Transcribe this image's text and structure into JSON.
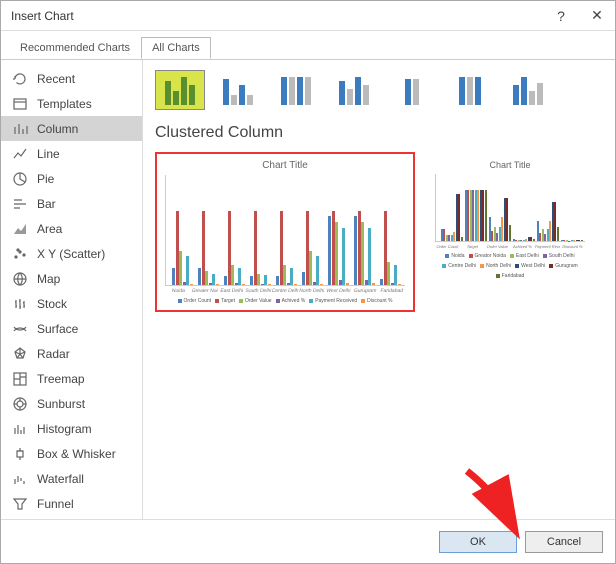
{
  "window": {
    "title": "Insert Chart",
    "help": "?",
    "close": "✕"
  },
  "tabs": {
    "recommended": "Recommended Charts",
    "all": "All Charts"
  },
  "sidebar": {
    "items": [
      {
        "label": "Recent",
        "icon": "recent"
      },
      {
        "label": "Templates",
        "icon": "templates"
      },
      {
        "label": "Column",
        "icon": "column"
      },
      {
        "label": "Line",
        "icon": "line"
      },
      {
        "label": "Pie",
        "icon": "pie"
      },
      {
        "label": "Bar",
        "icon": "bar"
      },
      {
        "label": "Area",
        "icon": "area"
      },
      {
        "label": "X Y (Scatter)",
        "icon": "scatter"
      },
      {
        "label": "Map",
        "icon": "map"
      },
      {
        "label": "Stock",
        "icon": "stock"
      },
      {
        "label": "Surface",
        "icon": "surface"
      },
      {
        "label": "Radar",
        "icon": "radar"
      },
      {
        "label": "Treemap",
        "icon": "treemap"
      },
      {
        "label": "Sunburst",
        "icon": "sunburst"
      },
      {
        "label": "Histogram",
        "icon": "histogram"
      },
      {
        "label": "Box & Whisker",
        "icon": "box"
      },
      {
        "label": "Waterfall",
        "icon": "waterfall"
      },
      {
        "label": "Funnel",
        "icon": "funnel"
      },
      {
        "label": "Combo",
        "icon": "combo"
      }
    ],
    "active": 2
  },
  "main": {
    "headline": "Clustered Column"
  },
  "preview1": {
    "title": "Chart Title",
    "type": "clustered-column-by-row",
    "categories": [
      "Noida",
      "Greater Noida",
      "East Delhi",
      "South Delhi",
      "Centre Delhi",
      "North Delhi",
      "West Delhi",
      "Gurugram",
      "Faridabad"
    ],
    "series": [
      {
        "name": "Order Count",
        "color": "#4f81bd"
      },
      {
        "name": "Target",
        "color": "#c0504d"
      },
      {
        "name": "Order Value",
        "color": "#9bbb59"
      },
      {
        "name": "Achived %",
        "color": "#8064a2"
      },
      {
        "name": "Payment Received",
        "color": "#4bacc6"
      },
      {
        "name": "Discount %",
        "color": "#f79646"
      }
    ],
    "y_ticks": [
      "200000",
      "400000",
      "600000",
      "800000",
      "1000000",
      "1200000",
      "1400000"
    ]
  },
  "preview2": {
    "title": "Chart Title",
    "type": "clustered-column-by-series",
    "categories": [
      "Order Count",
      "Target",
      "Order Value",
      "Achived %",
      "Payment Received",
      "Discount %"
    ],
    "series": [
      {
        "name": "Noida",
        "color": "#4f81bd"
      },
      {
        "name": "Greator Noida",
        "color": "#c0504d"
      },
      {
        "name": "East Delhi",
        "color": "#9bbb59"
      },
      {
        "name": "South Delhi",
        "color": "#8064a2"
      },
      {
        "name": "Centre Delhi",
        "color": "#4bacc6"
      },
      {
        "name": "North Delhi",
        "color": "#f79646"
      },
      {
        "name": "West Delhi",
        "color": "#2c4d75"
      },
      {
        "name": "Gurugram",
        "color": "#772c2a"
      },
      {
        "name": "Faridabad",
        "color": "#5f7530"
      }
    ],
    "y_ticks": [
      "200000",
      "400000",
      "600000",
      "800000",
      "1000000",
      "1200000",
      "1400000"
    ]
  },
  "chart_data": {
    "type": "bar",
    "title": "Chart Title",
    "ylabel": "",
    "xlabel": "",
    "ylim": [
      0,
      1400000
    ],
    "categories": [
      "Noida",
      "Greater Noida",
      "East Delhi",
      "South Delhi",
      "Centre Delhi",
      "North Delhi",
      "West Delhi",
      "Gurugram",
      "Faridabad"
    ],
    "series": [
      {
        "name": "Order Count",
        "values": [
          300000,
          300000,
          150000,
          150000,
          150000,
          220000,
          1200000,
          1200000,
          100000
        ]
      },
      {
        "name": "Target",
        "values": [
          1300000,
          1300000,
          1300000,
          1300000,
          1300000,
          1300000,
          1300000,
          1300000,
          1300000
        ]
      },
      {
        "name": "Order Value",
        "values": [
          600000,
          250000,
          350000,
          200000,
          350000,
          600000,
          1100000,
          1100000,
          400000
        ]
      },
      {
        "name": "Achived %",
        "values": [
          50000,
          30000,
          30000,
          20000,
          30000,
          50000,
          90000,
          90000,
          40000
        ]
      },
      {
        "name": "Payment Received",
        "values": [
          500000,
          200000,
          300000,
          180000,
          300000,
          500000,
          1000000,
          1000000,
          350000
        ]
      },
      {
        "name": "Discount %",
        "values": [
          20000,
          15000,
          15000,
          10000,
          15000,
          20000,
          30000,
          30000,
          15000
        ]
      }
    ]
  },
  "buttons": {
    "ok": "OK",
    "cancel": "Cancel"
  }
}
